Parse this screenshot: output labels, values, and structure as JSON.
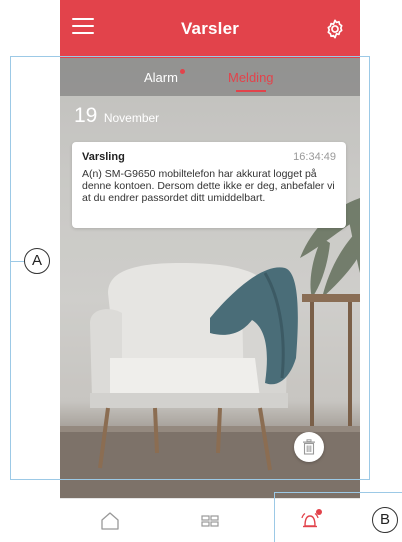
{
  "header": {
    "title": "Varsler",
    "menu_icon": "hamburger-menu-icon",
    "settings_icon": "gear-icon"
  },
  "tabs": [
    {
      "label": "Alarm",
      "active": false,
      "has_badge": true
    },
    {
      "label": "Melding",
      "active": true,
      "has_badge": false
    }
  ],
  "date": {
    "day": "19",
    "month": "November"
  },
  "notification": {
    "title": "Varsling",
    "time": "16:34:49",
    "text": "A(n) SM-G9650 mobiltelefon har akkurat logget på denne kontoen. Dersom dette ikke er deg, anbefaler vi at du endrer passordet ditt umiddelbart."
  },
  "actions": {
    "trash_icon": "trash-icon"
  },
  "bottom_nav": [
    {
      "name": "home",
      "icon": "home-icon",
      "active": false
    },
    {
      "name": "devices",
      "icon": "grid-icon",
      "active": false
    },
    {
      "name": "alerts",
      "icon": "alarm-bell-icon",
      "active": true,
      "has_badge": true
    }
  ],
  "callouts": {
    "a": "A",
    "b": "B"
  },
  "colors": {
    "accent": "#e2434b",
    "callout_line": "#9cc9e6"
  }
}
